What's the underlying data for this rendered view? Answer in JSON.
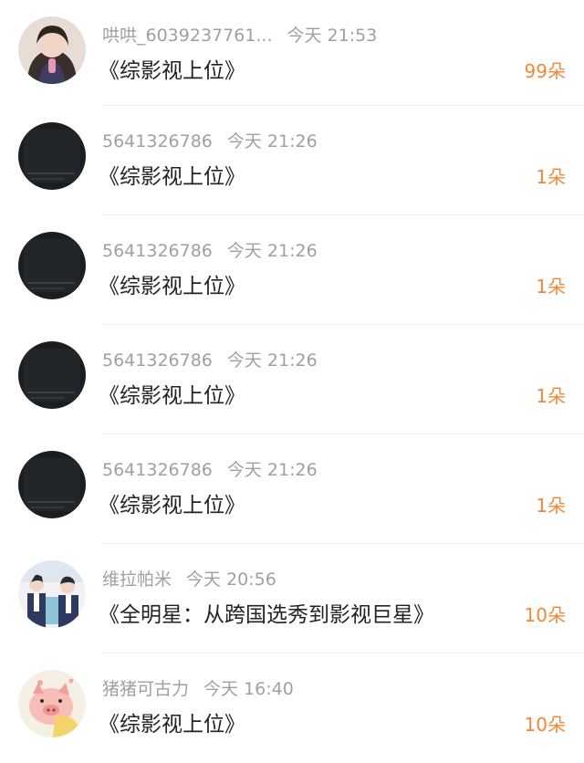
{
  "colors": {
    "username": "#a0a0a0",
    "title": "#222222",
    "count": "#f0883a",
    "divider": "#efefef"
  },
  "rows": [
    {
      "avatar_icon": "girl-photo-avatar",
      "username": "哄哄_6039237761...",
      "time": "今天 21:53",
      "title": "《综影视上位》",
      "count": "99朵"
    },
    {
      "avatar_icon": "dark-screen-avatar",
      "username": "5641326786",
      "time": "今天 21:26",
      "title": "《综影视上位》",
      "count": "1朵"
    },
    {
      "avatar_icon": "dark-screen-avatar",
      "username": "5641326786",
      "time": "今天 21:26",
      "title": "《综影视上位》",
      "count": "1朵"
    },
    {
      "avatar_icon": "dark-screen-avatar",
      "username": "5641326786",
      "time": "今天 21:26",
      "title": "《综影视上位》",
      "count": "1朵"
    },
    {
      "avatar_icon": "dark-screen-avatar",
      "username": "5641326786",
      "time": "今天 21:26",
      "title": "《综影视上位》",
      "count": "1朵"
    },
    {
      "avatar_icon": "group-photo-avatar",
      "username": "维拉帕米",
      "time": "今天 20:56",
      "title": "《全明星：从跨国选秀到影视巨星》",
      "count": "10朵"
    },
    {
      "avatar_icon": "pig-cartoon-avatar",
      "username": "猪猪可古力",
      "time": "今天 16:40",
      "title": "《综影视上位》",
      "count": "10朵"
    }
  ]
}
